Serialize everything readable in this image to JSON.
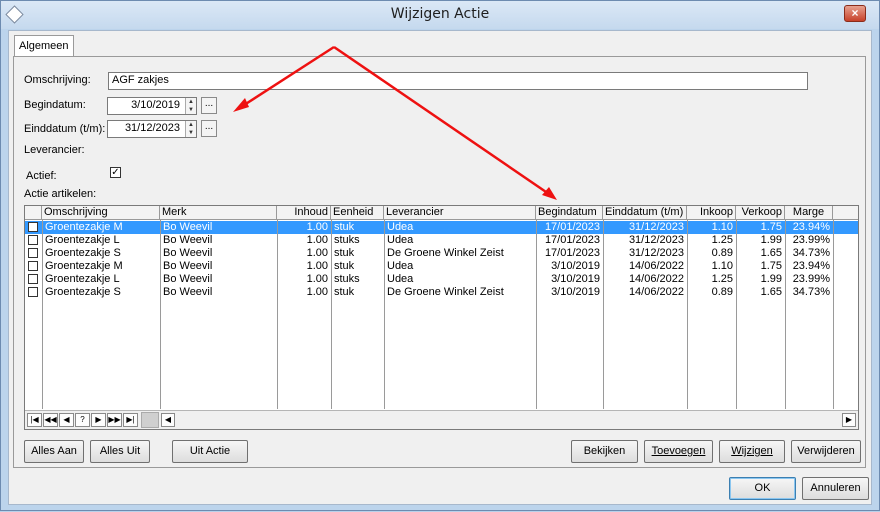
{
  "window": {
    "title": "Wijzigen Actie",
    "close_label": "×"
  },
  "tabs": [
    "Algemeen"
  ],
  "form": {
    "omschrijving_label": "Omschrijving:",
    "omschrijving_value": "AGF zakjes",
    "begindatum_label": "Begindatum:",
    "begindatum_value": "3/10/2019",
    "einddatum_label": "Einddatum (t/m):",
    "einddatum_value": "31/12/2023",
    "leverancier_label": "Leverancier:",
    "actief_label": "Actief:",
    "actief_checked": "✓",
    "artikelen_label": "Actie artikelen:",
    "dots": "..."
  },
  "grid": {
    "columns": [
      "Omschrijving",
      "Merk",
      "Inhoud",
      "Eenheid",
      "Leverancier",
      "Begindatum",
      "Einddatum (t/m)",
      "Inkoop",
      "Verkoop",
      "Marge"
    ],
    "rows": [
      [
        "Groentezakje M",
        "Bo Weevil",
        "1.00",
        "stuk",
        "Udea",
        "17/01/2023",
        "31/12/2023",
        "1.10",
        "1.75",
        "23.94%"
      ],
      [
        "Groentezakje L",
        "Bo Weevil",
        "1.00",
        "stuks",
        "Udea",
        "17/01/2023",
        "31/12/2023",
        "1.25",
        "1.99",
        "23.99%"
      ],
      [
        "Groentezakje S",
        "Bo Weevil",
        "1.00",
        "stuk",
        "De Groene Winkel Zeist",
        "17/01/2023",
        "31/12/2023",
        "0.89",
        "1.65",
        "34.73%"
      ],
      [
        "Groentezakje M",
        "Bo Weevil",
        "1.00",
        "stuk",
        "Udea",
        "3/10/2019",
        "14/06/2022",
        "1.10",
        "1.75",
        "23.94%"
      ],
      [
        "Groentezakje L",
        "Bo Weevil",
        "1.00",
        "stuks",
        "Udea",
        "3/10/2019",
        "14/06/2022",
        "1.25",
        "1.99",
        "23.99%"
      ],
      [
        "Groentezakje S",
        "Bo Weevil",
        "1.00",
        "stuk",
        "De Groene Winkel Zeist",
        "3/10/2019",
        "14/06/2022",
        "0.89",
        "1.65",
        "34.73%"
      ]
    ],
    "selected_row": 0,
    "nav_buttons": [
      "|◀",
      "◀◀",
      "◀",
      "?",
      "▶",
      "▶▶",
      "▶|"
    ]
  },
  "buttons": {
    "alles_aan": "Alles Aan",
    "alles_uit": "Alles Uit",
    "uit_actie": "Uit Actie",
    "bekijken": "Bekijken",
    "toevoegen": "Toevoegen",
    "wijzigen": "Wijzigen",
    "verwijderen": "Verwijderen",
    "ok": "OK",
    "annuleren": "Annuleren"
  },
  "colors": {
    "selection": "#3399ff",
    "annotation_arrow": "#ff0000"
  }
}
